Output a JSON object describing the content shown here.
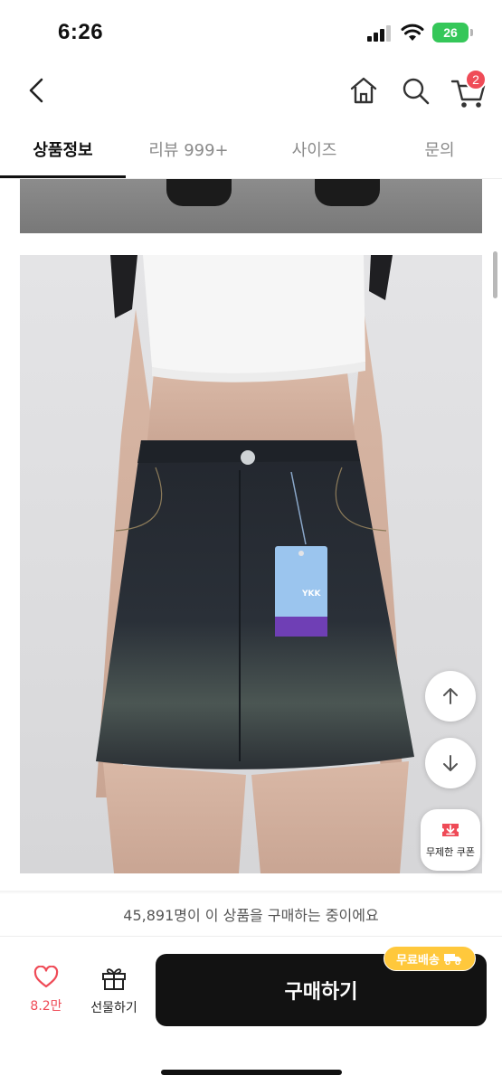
{
  "status_bar": {
    "time": "6:26",
    "battery": "26"
  },
  "nav": {
    "cart_count": "2"
  },
  "tabs": [
    {
      "label": "상품정보",
      "active": true
    },
    {
      "label": "리뷰 999+",
      "active": false
    },
    {
      "label": "사이즈",
      "active": false
    },
    {
      "label": "문의",
      "active": false
    }
  ],
  "product_tag": {
    "brand": "YKK"
  },
  "floating": {
    "coupon_label": "무제한 쿠폰"
  },
  "banner": {
    "text": "45,891명이 이 상품을 구매하는 중이에요"
  },
  "bottom_bar": {
    "like_count": "8.2만",
    "gift_label": "선물하기",
    "buy_label": "구매하기",
    "free_shipping_label": "무료배송"
  },
  "colors": {
    "accent_red": "#ef4b57",
    "buy_button": "#121212",
    "shipping_badge": "#ffc83c"
  }
}
